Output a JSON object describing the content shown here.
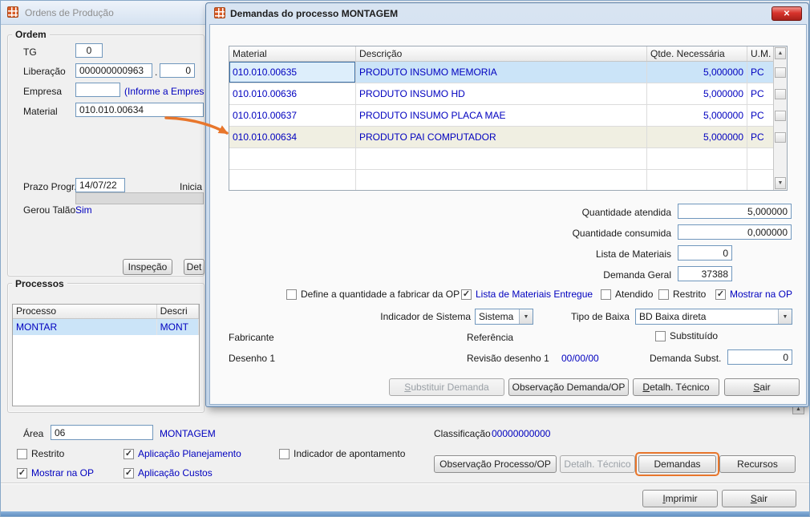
{
  "icons": {
    "close": "✕",
    "dropdown": "▼",
    "up": "▲",
    "down": "▼",
    "check": "✓"
  },
  "colors": {
    "annotation_orange": "#e8762c",
    "selection_blue": "#cbe4f8",
    "data_blue": "#0000bf"
  },
  "main": {
    "title": "Ordens de Produção",
    "ordem": {
      "group_label": "Ordem",
      "tg_label": "TG",
      "tg_value": "0",
      "liberacao_label": "Liberação",
      "liberacao_value": "000000000963",
      "liberacao_sep": ".",
      "liberacao_seq": "0",
      "empresa_label": "Empresa",
      "empresa_value": "",
      "empresa_hint": "(Informe a Empres",
      "material_label": "Material",
      "material_value": "010.010.00634",
      "prazo_label": "Prazo Progr.",
      "prazo_value": "14/07/22",
      "inicia_label": "Inicia",
      "gerou_talao_label": "Gerou Talão",
      "gerou_talao_value": "Sim",
      "inspecao_button": "Inspeção",
      "det_button": "Det"
    },
    "processos": {
      "group_label": "Processos",
      "columns": [
        "Processo",
        "Descri"
      ],
      "row": {
        "processo": "MONTAR",
        "descricao": "MONT"
      }
    },
    "area_label": "Área",
    "area_value": "06",
    "area_name": "MONTAGEM",
    "classificacao_label": "Classificação",
    "classificacao_value": "00000000000",
    "checkboxes": {
      "restrito": "Restrito",
      "aplicacao_planejamento": "Aplicação Planejamento",
      "indicador_apontamento": "Indicador de apontamento",
      "mostrar_na_op": "Mostrar na OP",
      "aplicacao_custos": "Aplicação Custos"
    },
    "buttons": {
      "observacao_processo": "Observação Processo/OP",
      "detalh_tecnico": "Detalh. Técnico",
      "demandas": "Demandas",
      "recursos": "Recursos",
      "imprimir": "Imprimir",
      "sair": "Sair"
    }
  },
  "dialog": {
    "title": "Demandas do processo MONTAGEM",
    "table": {
      "columns": [
        "Material",
        "Descrição",
        "Qtde. Necessária",
        "U.M."
      ],
      "rows": [
        {
          "material": "010.010.00635",
          "descricao": "PRODUTO INSUMO MEMORIA",
          "qtde": "5,000000",
          "um": "PC"
        },
        {
          "material": "010.010.00636",
          "descricao": "PRODUTO INSUMO HD",
          "qtde": "5,000000",
          "um": "PC"
        },
        {
          "material": "010.010.00637",
          "descricao": "PRODUTO INSUMO PLACA MAE",
          "qtde": "5,000000",
          "um": "PC"
        },
        {
          "material": "010.010.00634",
          "descricao": "PRODUTO PAI COMPUTADOR",
          "qtde": "5,000000",
          "um": "PC"
        }
      ]
    },
    "fields": {
      "qtd_atendida_label": "Quantidade atendida",
      "qtd_atendida_value": "5,000000",
      "qtd_consumida_label": "Quantidade consumida",
      "qtd_consumida_value": "0,000000",
      "lista_materiais_label": "Lista de Materiais",
      "lista_materiais_value": "0",
      "demanda_geral_label": "Demanda Geral",
      "demanda_geral_value": "37388"
    },
    "checkboxes": {
      "define_qtd": "Define a quantidade a fabricar da OP",
      "lista_entregue": "Lista de Materiais Entregue",
      "atendido": "Atendido",
      "restrito": "Restrito",
      "mostrar_na_op": "Mostrar na OP",
      "substituido": "Substituído"
    },
    "dropdowns": {
      "indicador_label": "Indicador de Sistema",
      "indicador_value": "Sistema",
      "tipo_baixa_label": "Tipo de Baixa",
      "tipo_baixa_value": "BD Baixa direta"
    },
    "info": {
      "fabricante_label": "Fabricante",
      "referencia_label": "Referência",
      "desenho_label": "Desenho 1",
      "revisao_label": "Revisão desenho 1",
      "revisao_value": "00/00/00",
      "demanda_subst_label": "Demanda Subst.",
      "demanda_subst_value": "0"
    },
    "buttons": {
      "substituir": "Substituir Demanda",
      "observacao": "Observação Demanda/OP",
      "detalh": "Detalh. Técnico",
      "sair": "Sair"
    }
  }
}
